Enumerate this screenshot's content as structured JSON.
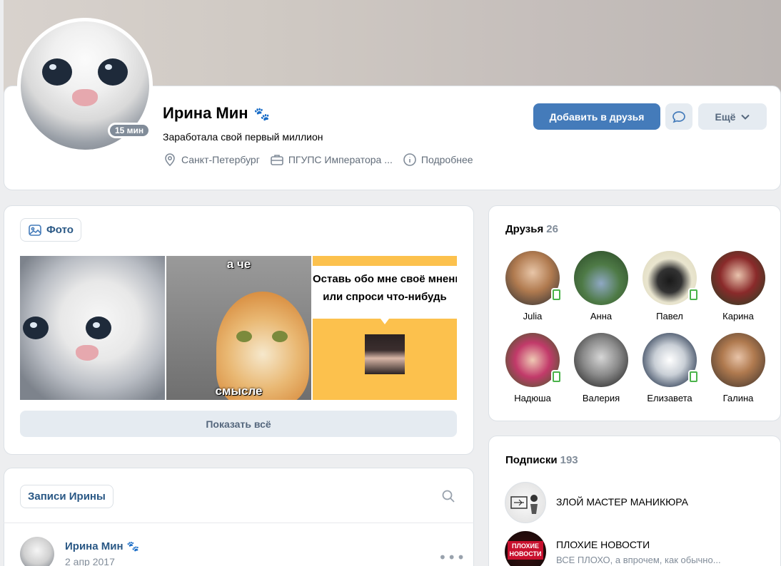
{
  "profile": {
    "name": "Ирина Мин",
    "status": "Заработала свой первый миллион",
    "online": "15 мин",
    "info": {
      "city": "Санкт-Петербург",
      "work": "ПГУПС Императора ...",
      "details": "Подробнее"
    },
    "buttons": {
      "add_friend": "Добавить в друзья",
      "more": "Ещё"
    }
  },
  "photos": {
    "tab_label": "Фото",
    "meme2_top": "а че",
    "meme2_bottom": "смысле",
    "meme3_line1": "Оставь обо мне своё мнение",
    "meme3_line2": "или спроси что-нибудь",
    "show_all": "Показать всё"
  },
  "wall": {
    "tab_label": "Записи Ирины",
    "post": {
      "author": "Ирина Мин",
      "date": "2 апр 2017"
    }
  },
  "friends": {
    "title": "Друзья",
    "count": "26",
    "items": [
      {
        "name": "Julia"
      },
      {
        "name": "Анна"
      },
      {
        "name": "Павел"
      },
      {
        "name": "Карина"
      },
      {
        "name": "Надюша"
      },
      {
        "name": "Валерия"
      },
      {
        "name": "Елизавета"
      },
      {
        "name": "Галина"
      }
    ]
  },
  "subscriptions": {
    "title": "Подписки",
    "count": "193",
    "items": [
      {
        "name": "ЗЛОЙ МАСТЕР МАНИКЮРА",
        "desc": ""
      },
      {
        "name": "ПЛОХИЕ НОВОСТИ",
        "desc": "ВСЕ ПЛОХО, а впрочем, как обычно..."
      }
    ],
    "logo2_text": "ПЛОХИЕ НОВОСТИ"
  },
  "colors": {
    "accent": "#447bba",
    "link": "#2a5885",
    "secondary_bg": "#e5ebf1",
    "page_bg": "#edeef0"
  }
}
